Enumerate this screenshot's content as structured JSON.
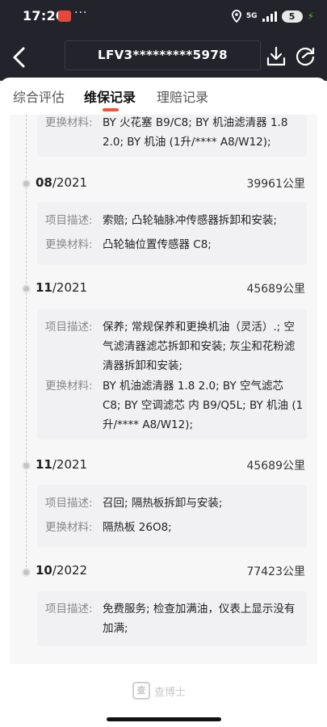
{
  "status": {
    "time": "17:20",
    "dots": "···",
    "network": "5G",
    "battery": "5"
  },
  "header": {
    "vin": "LFV3*********5978",
    "back_icon": "back-arrow-icon",
    "download_icon": "download-icon",
    "share_icon": "share-icon"
  },
  "tabs": [
    {
      "label": "综合评估",
      "active": false
    },
    {
      "label": "维保记录",
      "active": true
    },
    {
      "label": "理赔记录",
      "active": false
    }
  ],
  "labels": {
    "desc": "项目描述:",
    "parts": "更换材料:"
  },
  "records": [
    {
      "parts": "BY 火花塞 B9/C8; BY 机油滤清器 1.8 2.0; BY 机油 (1升/**** A8/W12);"
    },
    {
      "month": "08",
      "year": "/2021",
      "km": "39961公里",
      "desc": "索赔; 凸轮轴脉冲传感器拆卸和安装;",
      "parts": "凸轮轴位置传感器 C8;"
    },
    {
      "month": "11",
      "year": "/2021",
      "km": "45689公里",
      "desc": "保养; 常规保养和更换机油（灵活）.; 空气滤清器滤芯拆卸和安装; 灰尘和花粉滤清器拆卸和安装;",
      "parts": "BY 机油滤清器 1.8 2.0; BY 空气滤芯 C8; BY 空调滤芯 内 B9/Q5L; BY 机油 (1升/**** A8/W12);"
    },
    {
      "month": "11",
      "year": "/2021",
      "km": "45689公里",
      "desc": "召回; 隔热板拆卸与安装;",
      "parts": "隔热板 26O8;"
    },
    {
      "month": "10",
      "year": "/2022",
      "km": "77423公里",
      "desc": "免费服务; 检查加满油，仪表上显示没有加满;"
    }
  ],
  "watermark": {
    "glyph": "查",
    "text": "查博士"
  }
}
